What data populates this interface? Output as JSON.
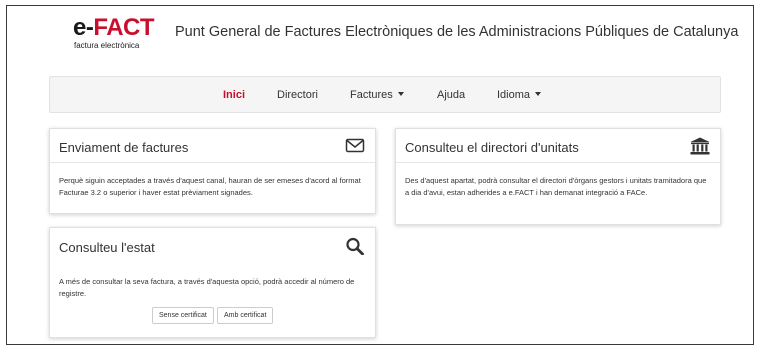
{
  "header": {
    "logo": {
      "e": "e",
      "dash": "-",
      "fact": "FACT",
      "subtitle": "factura electrònica"
    },
    "title": "Punt General de Factures Electròniques de les Administracions Públiques de Catalunya"
  },
  "nav": {
    "items": [
      {
        "label": "Inici",
        "active": true,
        "dropdown": false
      },
      {
        "label": "Directori",
        "active": false,
        "dropdown": false
      },
      {
        "label": "Factures",
        "active": false,
        "dropdown": true
      },
      {
        "label": "Ajuda",
        "active": false,
        "dropdown": false
      },
      {
        "label": "Idioma",
        "active": false,
        "dropdown": true
      }
    ]
  },
  "cards": {
    "enviament": {
      "title": "Enviament de factures",
      "icon": "envelope-icon",
      "text": "Perquè siguin acceptades a través d'aquest canal, hauran de ser emeses d'acord al format Facturae 3.2 o superior i haver estat prèviament signades."
    },
    "directori": {
      "title": "Consulteu el directori d'unitats",
      "icon": "institution-icon",
      "text": "Des d'aquest apartat, podrà consultar el directori d'òrgans gestors i unitats tramitadora que a dia d'avui, estan adherides a e.FACT i han demanat integració a FACe."
    },
    "estat": {
      "title": "Consulteu l'estat",
      "icon": "search-icon",
      "text": "A més de consultar la seva factura, a través d'aquesta opció, podrà accedir al número de registre.",
      "buttons": [
        "Sense certificat",
        "Amb certificat"
      ]
    }
  },
  "colors": {
    "brand_red": "#c8102e",
    "nav_bg": "#f5f5f5"
  }
}
